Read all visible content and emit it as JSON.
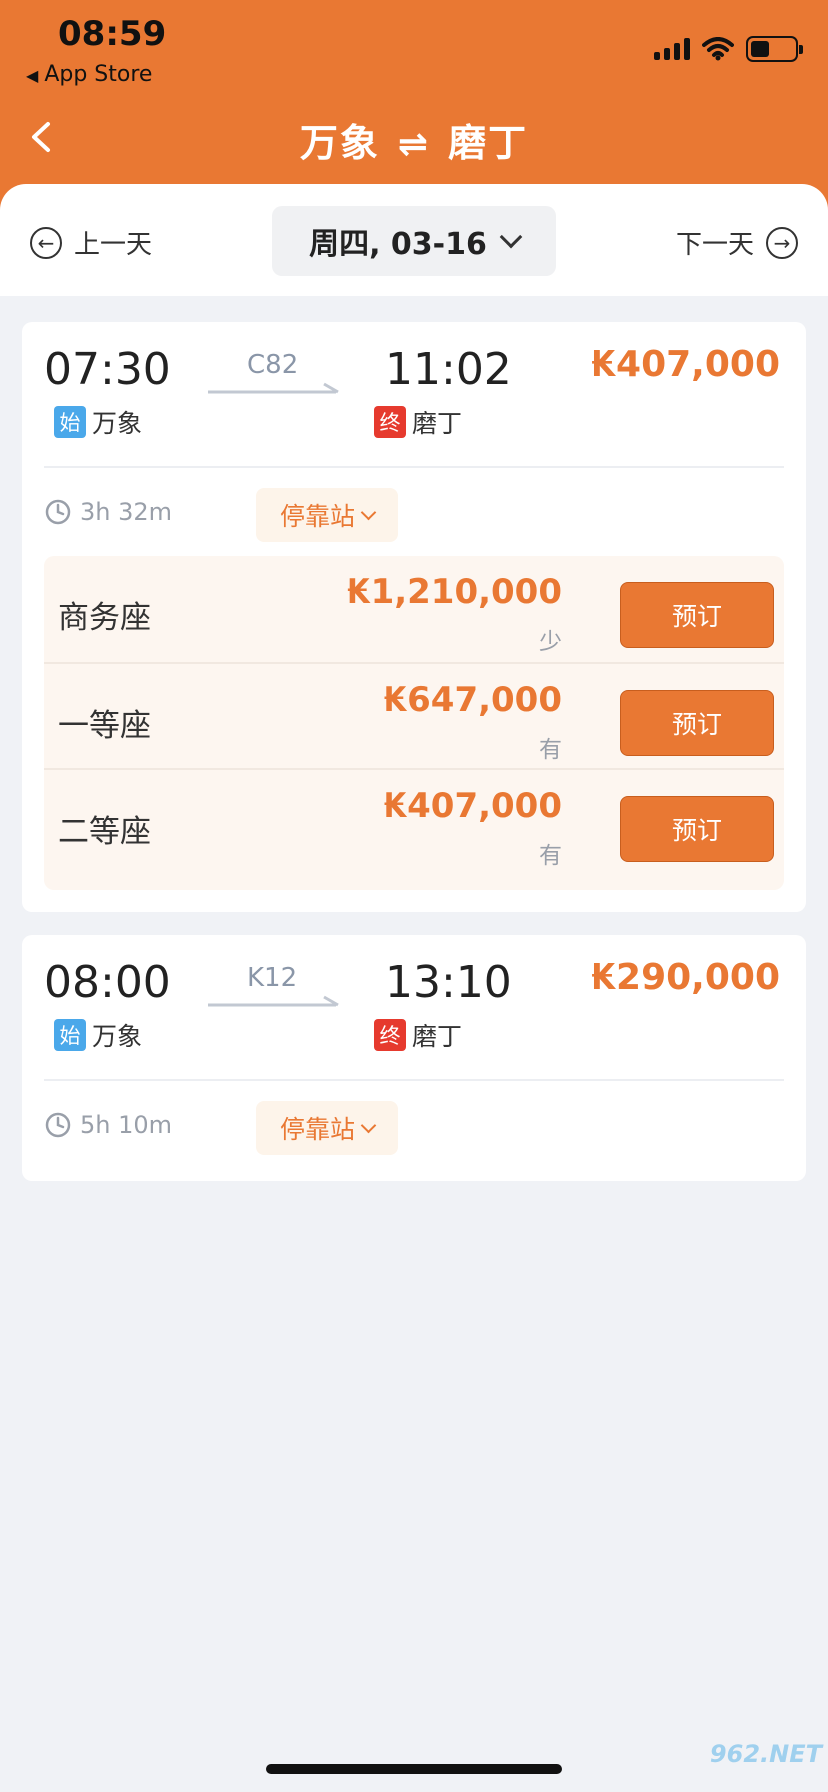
{
  "status_bar": {
    "time": "08:59",
    "back_app": "App Store"
  },
  "header": {
    "from": "万象",
    "swap_symbol": "⇌",
    "to": "磨丁"
  },
  "date_bar": {
    "prev_label": "上一天",
    "date_label": "周四, 03-16",
    "next_label": "下一天"
  },
  "trains": [
    {
      "dep_time": "07:30",
      "train_no": "C82",
      "arr_time": "11:02",
      "min_price": "₭407,000",
      "start_tag": "始",
      "dep_station": "万象",
      "end_tag": "终",
      "arr_station": "磨丁",
      "duration": "3h 32m",
      "stops_label": "停靠站",
      "seats": [
        {
          "name": "商务座",
          "price": "₭1,210,000",
          "availability": "少",
          "book_label": "预订"
        },
        {
          "name": "一等座",
          "price": "₭647,000",
          "availability": "有",
          "book_label": "预订"
        },
        {
          "name": "二等座",
          "price": "₭407,000",
          "availability": "有",
          "book_label": "预订"
        }
      ]
    },
    {
      "dep_time": "08:00",
      "train_no": "K12",
      "arr_time": "13:10",
      "min_price": "₭290,000",
      "start_tag": "始",
      "dep_station": "万象",
      "end_tag": "终",
      "arr_station": "磨丁",
      "duration": "5h 10m",
      "stops_label": "停靠站"
    }
  ],
  "watermark": "962.NET",
  "colors": {
    "accent": "#e97833",
    "start_tag": "#4aa8ea",
    "end_tag": "#e63a2e",
    "background": "#f0f2f6"
  }
}
